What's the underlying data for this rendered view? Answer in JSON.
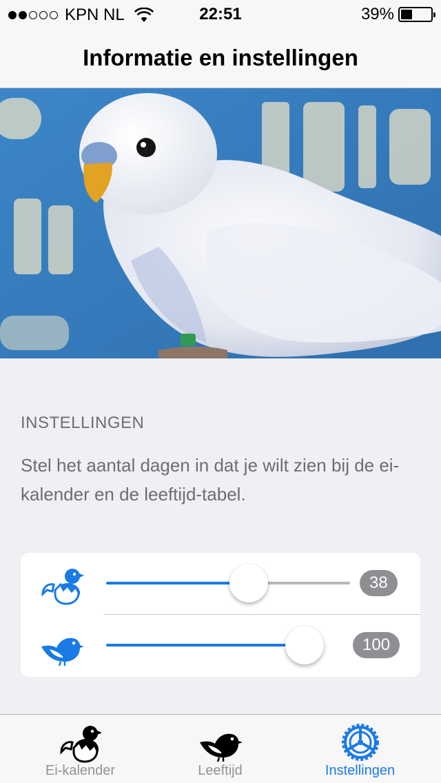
{
  "status_bar": {
    "carrier": "KPN NL",
    "time": "22:51",
    "battery": "39%",
    "battery_level": 0.39
  },
  "nav": {
    "title": "Informatie en instellingen"
  },
  "settings": {
    "header": "INSTELLINGEN",
    "description": "Stel het aantal dagen in dat je wilt zien bij de ei-kalender en de leeftijd-tabel.",
    "sliders": [
      {
        "icon": "hatching-chick-icon",
        "value": "38",
        "position": 0.6
      },
      {
        "icon": "bird-icon",
        "value": "100",
        "position": 1.0
      }
    ]
  },
  "tabs": [
    {
      "label": "Ei-kalender",
      "icon": "hatching-chick-icon",
      "active": false
    },
    {
      "label": "Leeftijd",
      "icon": "bird-icon",
      "active": false
    },
    {
      "label": "Instellingen",
      "icon": "settings-wheel-icon",
      "active": true
    }
  ],
  "colors": {
    "accent": "#1a7ae6",
    "inactive": "#929292",
    "badge": "#8e8e93"
  }
}
